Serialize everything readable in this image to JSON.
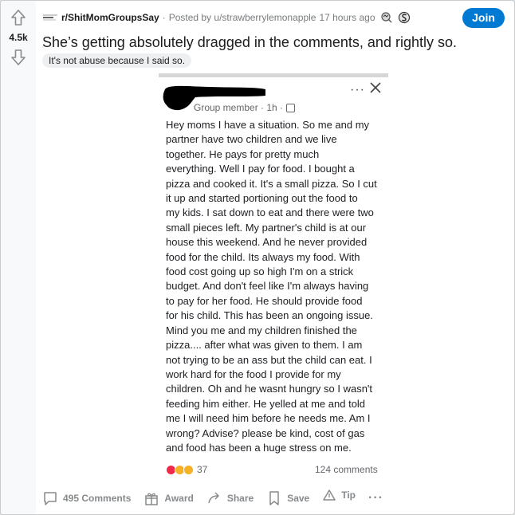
{
  "vote": {
    "count": "4.5k"
  },
  "header": {
    "subreddit": "r/ShitMomGroupsSay",
    "posted_by": "Posted by u/strawberrylemonapple",
    "time": "17 hours ago",
    "join_label": "Join"
  },
  "post": {
    "title": "She’s getting absolutely dragged in the comments, and rightly so.",
    "flair": "It's not abuse because I said so."
  },
  "screenshot": {
    "role": "Group member · 1h ·",
    "more": "···",
    "body_lines": [
      "Hey moms I have a situation.  So me and my",
      "partner  have two children and we live",
      "together.  He pays for pretty much",
      "everything.  Well I pay for food. I bought a",
      "pizza and cooked it. It's a small pizza. So I cut",
      "it up and started portioning out the food to",
      "my kids. I sat down to eat and there were two",
      "small pieces left. My partner's child is at our",
      "house this weekend.  And he never provided",
      "food for the child. Its always my food. With",
      "food cost going up so high I'm on a strick",
      "budget.  And don't feel like I'm always having",
      "to pay for her food. He should  provide  food",
      "for his child. This has  been an ongoing issue.",
      "Mind you  me and my children finished the",
      "pizza.... after what was given to them. I am",
      "not trying to be an ass but the child can eat. I",
      "work hard for the food I provide  for  my",
      "children. Oh and he  wasnt hungry so I wasn't",
      "feeding him either.  He yelled at me and told",
      "me I will need him before he needs me. Am I",
      "wrong? Advise? please  be kind, cost of gas",
      "and food has been a huge stress on me."
    ],
    "reaction_count": "37",
    "comments": "124 comments",
    "reaction_colors": [
      "#f0284a",
      "#f7b125",
      "#f7b125"
    ]
  },
  "actions": {
    "comments": "495 Comments",
    "award": "Award",
    "share": "Share",
    "save": "Save",
    "tip": "Tip",
    "more": "···"
  },
  "colors": {
    "accent": "#0079d3",
    "muted": "#878a8c"
  }
}
